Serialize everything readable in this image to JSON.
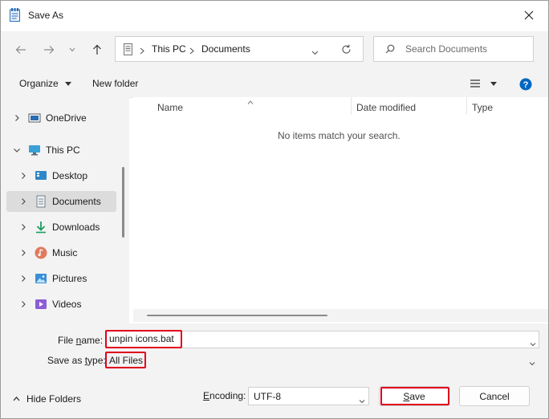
{
  "window": {
    "title": "Save As"
  },
  "address": {
    "segments": [
      "This PC",
      "Documents"
    ]
  },
  "search": {
    "placeholder": "Search Documents"
  },
  "commands": {
    "organize": "Organize",
    "new_folder": "New folder"
  },
  "tree": {
    "onedrive": "OneDrive",
    "this_pc": "This PC",
    "desktop": "Desktop",
    "documents": "Documents",
    "downloads": "Downloads",
    "music": "Music",
    "pictures": "Pictures",
    "videos": "Videos"
  },
  "columns": {
    "name": "Name",
    "date_modified": "Date modified",
    "type": "Type"
  },
  "empty_message": "No items match your search.",
  "file_name": {
    "label_pre": "File ",
    "label_u": "n",
    "label_post": "ame:",
    "value": "unpin icons.bat"
  },
  "save_type": {
    "label_pre": "Save as ",
    "label_u": "t",
    "label_post": "ype:",
    "value": "All Files"
  },
  "hide_folders": "Hide Folders",
  "encoding": {
    "label_pre": "",
    "label_u": "E",
    "label_post": "ncoding:",
    "value": "UTF-8"
  },
  "buttons": {
    "save_u": "S",
    "save_post": "ave",
    "cancel": "Cancel"
  },
  "colors": {
    "highlight_red": "#e0001b",
    "accent_blue": "#0067c0"
  }
}
